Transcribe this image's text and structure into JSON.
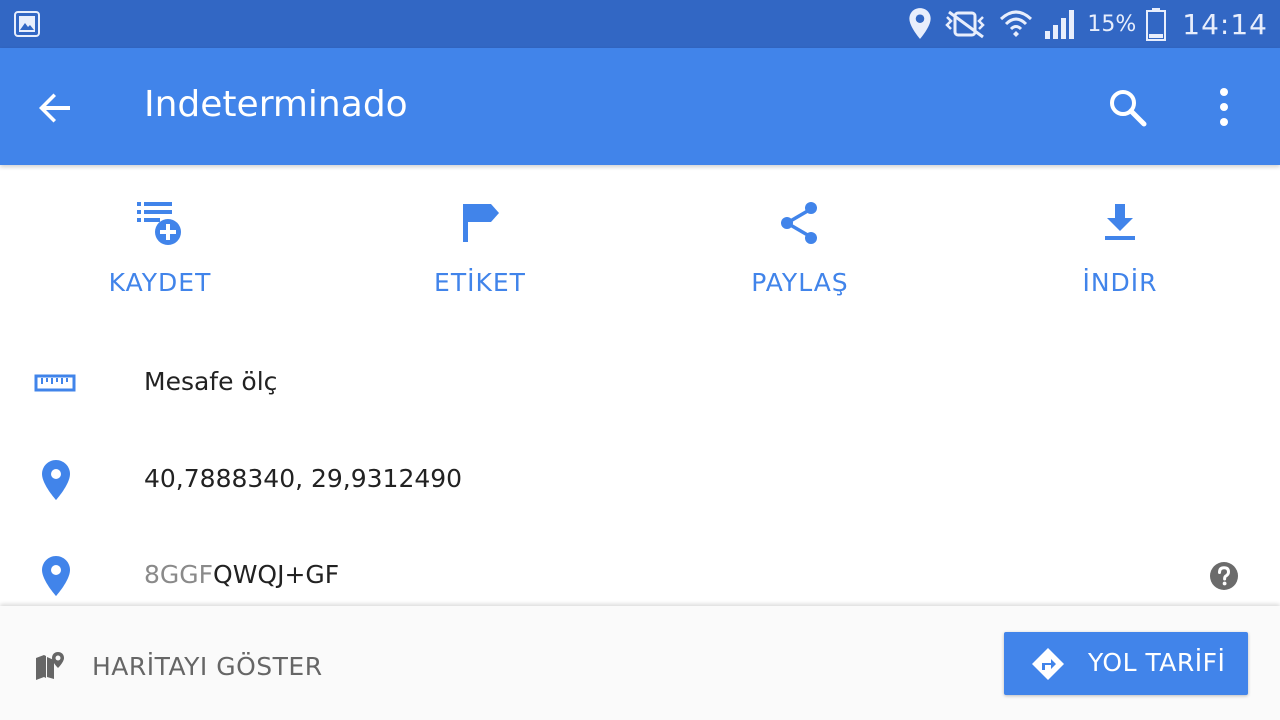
{
  "status_bar": {
    "battery_percent": "15%",
    "time": "14:14",
    "icons": [
      "gallery-icon",
      "location-icon",
      "mute-vibrate-icon",
      "wifi-icon",
      "signal-icon",
      "battery-icon"
    ]
  },
  "app_bar": {
    "title": "Indeterminado",
    "icons": [
      "back-arrow-icon",
      "search-icon",
      "more-vert-icon"
    ]
  },
  "actions": [
    {
      "label": "KAYDET",
      "icon": "playlist-add-icon"
    },
    {
      "label": "ETİKET",
      "icon": "flag-icon"
    },
    {
      "label": "PAYLAŞ",
      "icon": "share-icon"
    },
    {
      "label": "İNDİR",
      "icon": "download-icon"
    }
  ],
  "rows": {
    "measure": {
      "label": "Mesafe ölç",
      "icon": "ruler-icon"
    },
    "coordinates": {
      "value": "40,7888340, 29,9312490",
      "icon": "place-icon"
    },
    "plus_code": {
      "prefix": "8GGF",
      "code": "QWQJ+GF",
      "icon": "place-icon",
      "help_icon": "help-icon"
    }
  },
  "bottom_bar": {
    "show_map_label": "HARİTAYI GÖSTER",
    "directions_label": "YOL TARİFİ"
  },
  "colors": {
    "status_bar": "#3267c4",
    "app_bar": "#4184ea",
    "accent": "#4184ea"
  }
}
